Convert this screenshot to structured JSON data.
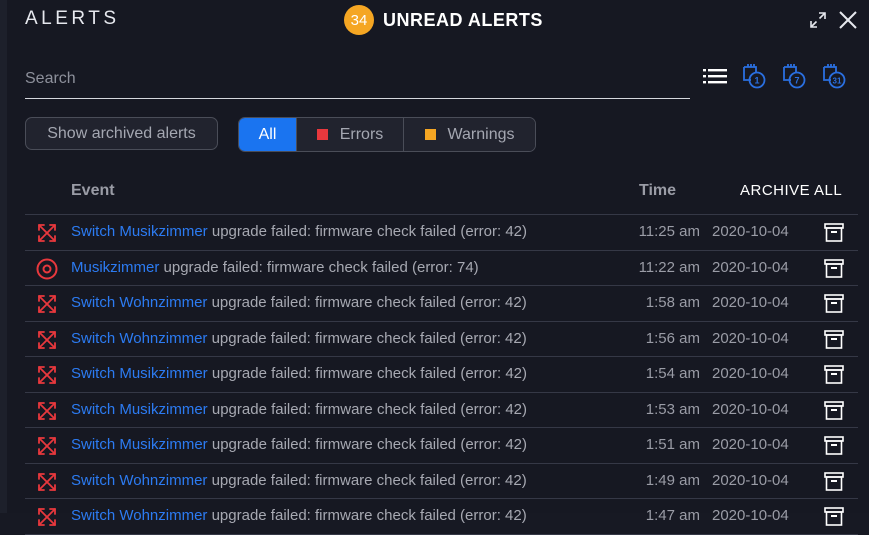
{
  "header": {
    "title": "ALERTS",
    "unread_count": "34",
    "unread_label": "UNREAD ALERTS",
    "expand_icon": "expand-icon",
    "close_icon": "close-icon"
  },
  "search": {
    "placeholder": "Search",
    "value": ""
  },
  "toolbar": {
    "icons": [
      "list-icon",
      "calendar-1-day-icon",
      "calendar-7-days-icon",
      "calendar-31-days-icon"
    ],
    "calendar_labels": [
      "1",
      "7",
      "31"
    ]
  },
  "filters": {
    "archived_label": "Show archived alerts",
    "segments": [
      {
        "label": "All",
        "active": true
      },
      {
        "label": "Errors",
        "color": "#e8383d"
      },
      {
        "label": "Warnings",
        "color": "#f5a623"
      }
    ]
  },
  "table": {
    "headers": {
      "event": "Event",
      "time": "Time",
      "archive_all": "ARCHIVE ALL"
    },
    "rows": [
      {
        "icon": "switch-icon",
        "device": "Switch Musikzimmer",
        "message": "upgrade failed: firmware check failed (error: 42)",
        "time": "11:25 am",
        "date": "2020-10-04"
      },
      {
        "icon": "access-point-icon",
        "device": "Musikzimmer",
        "message": "upgrade failed: firmware check failed (error: 74)",
        "time": "11:22 am",
        "date": "2020-10-04"
      },
      {
        "icon": "switch-icon",
        "device": "Switch Wohnzimmer",
        "message": "upgrade failed: firmware check failed (error: 42)",
        "time": "1:58 am",
        "date": "2020-10-04"
      },
      {
        "icon": "switch-icon",
        "device": "Switch Wohnzimmer",
        "message": "upgrade failed: firmware check failed (error: 42)",
        "time": "1:56 am",
        "date": "2020-10-04"
      },
      {
        "icon": "switch-icon",
        "device": "Switch Musikzimmer",
        "message": "upgrade failed: firmware check failed (error: 42)",
        "time": "1:54 am",
        "date": "2020-10-04"
      },
      {
        "icon": "switch-icon",
        "device": "Switch Musikzimmer",
        "message": "upgrade failed: firmware check failed (error: 42)",
        "time": "1:53 am",
        "date": "2020-10-04"
      },
      {
        "icon": "switch-icon",
        "device": "Switch Musikzimmer",
        "message": "upgrade failed: firmware check failed (error: 42)",
        "time": "1:51 am",
        "date": "2020-10-04"
      },
      {
        "icon": "switch-icon",
        "device": "Switch Wohnzimmer",
        "message": "upgrade failed: firmware check failed (error: 42)",
        "time": "1:49 am",
        "date": "2020-10-04"
      },
      {
        "icon": "switch-icon",
        "device": "Switch Wohnzimmer",
        "message": "upgrade failed: firmware check failed (error: 42)",
        "time": "1:47 am",
        "date": "2020-10-04"
      }
    ]
  },
  "colors": {
    "accent": "#1a74f0",
    "error": "#e8383d",
    "warning": "#f5a623",
    "link": "#2c7bf2",
    "background": "#161822"
  }
}
